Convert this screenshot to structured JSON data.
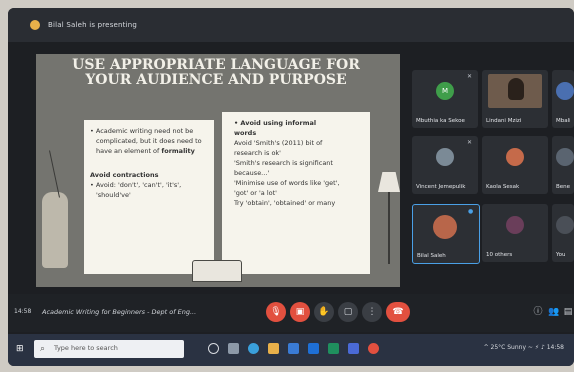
{
  "window": {
    "title": "Bilal Saleh is presenting"
  },
  "slide": {
    "title_line1": "USE APPROPRIATE LANGUAGE FOR",
    "title_line2": "YOUR AUDIENCE AND PURPOSE",
    "left_card": {
      "bullet1_text": "Academic writing need not be complicated, but it does need to have an element of",
      "bullet1_bold": "formality",
      "subheading": "Avoid contractions",
      "bullet2": "Avoid: 'don't', 'can't', 'it's', 'should've'"
    },
    "right_card": {
      "heading_line1": "Avoid using informal",
      "heading_line2": "words",
      "lines": [
        "Avoid 'Smith's (2011) bit of",
        "research is ok'",
        "'Smith's research is significant",
        "because...'",
        "'Minimise use of words like 'get',",
        "'got' or 'a lot'",
        "Try 'obtain', 'obtained' or many"
      ]
    }
  },
  "participants": [
    {
      "initials": "M",
      "name": "Mbuthia ka Sekoe",
      "color": "#3f9e4a"
    },
    {
      "initials": "",
      "name": "Lindani Mzizi",
      "color": "#6e5b4c",
      "camera": true
    },
    {
      "initials": "",
      "name": "Mbali Ndlovu",
      "color": "#4a6fb0"
    },
    {
      "initials": "",
      "name": "Vincent Jemepulik",
      "color": "#7b8a96"
    },
    {
      "initials": "",
      "name": "Kaola Sesak",
      "color": "#c56a4a"
    },
    {
      "initials": "",
      "name": "Benedict",
      "color": "#5a6470"
    },
    {
      "initials": "",
      "name": "Bilal Saleh",
      "color": "#b8664a"
    },
    {
      "initials": "",
      "name": "10 others",
      "color": "#6a3e5a"
    },
    {
      "initials": "",
      "name": "You",
      "color": "#4a4f57"
    }
  ],
  "meeting": {
    "time": "14:58",
    "name": "Academic Writing for Beginners - Dept of Eng..."
  },
  "controls": {
    "mic_icon": "mic-off-icon",
    "camera_icon": "camera-off-icon",
    "hand_icon": "raise-hand-icon",
    "present_icon": "present-icon",
    "more_icon": "more-options-icon",
    "end_icon": "end-call-icon"
  },
  "taskbar": {
    "search_placeholder": "Type here to search",
    "tray_text": "^ 25°C Sunny ~ ⚡ ♪ 14:58"
  }
}
